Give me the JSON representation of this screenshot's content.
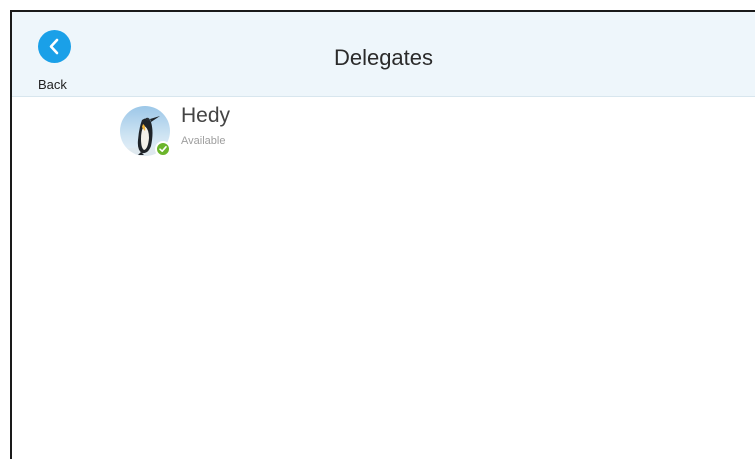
{
  "header": {
    "title": "Delegates",
    "back_label": "Back"
  },
  "delegates": [
    {
      "name": "Hedy",
      "status": "Available",
      "avatar_icon": "penguin-avatar-icon",
      "presence_icon": "available-check-icon"
    }
  ],
  "colors": {
    "accent": "#1aa0e8",
    "header_bg": "#eef6fb",
    "available": "#6bb52b"
  }
}
